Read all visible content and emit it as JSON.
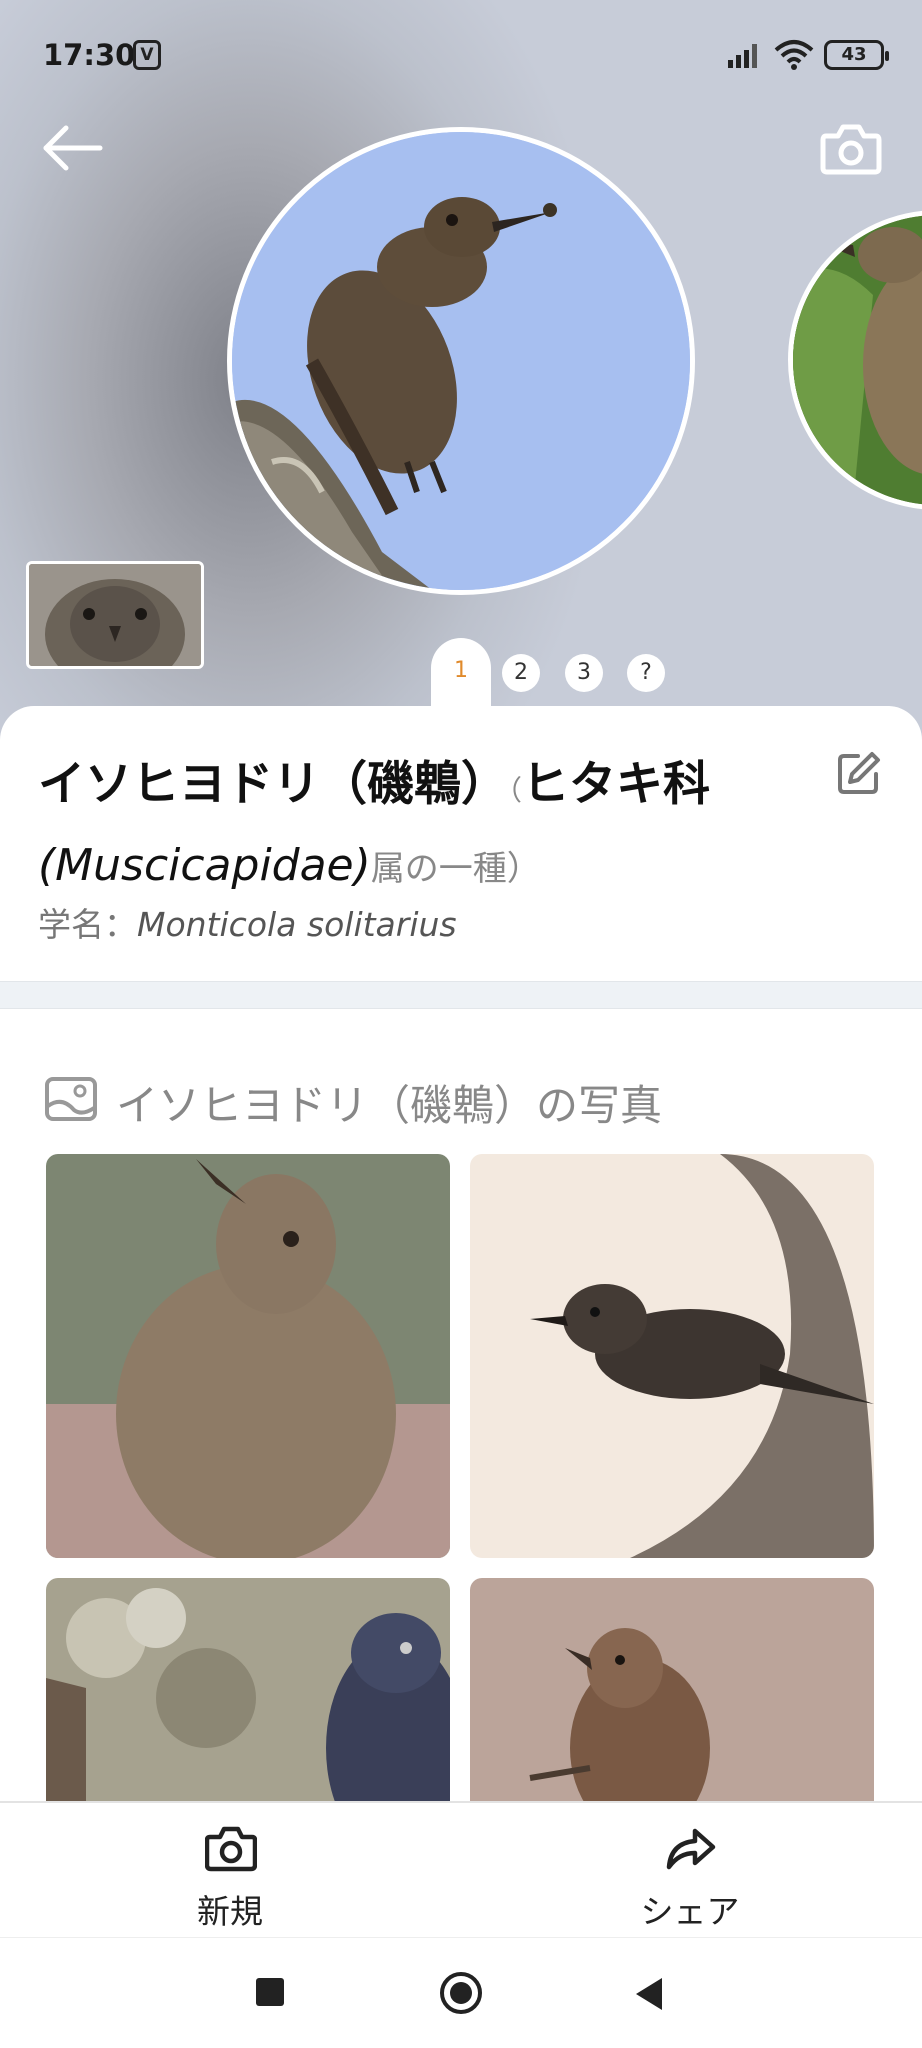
{
  "status_bar": {
    "time": "17:30",
    "app_badge": "V",
    "battery": "43"
  },
  "header": {
    "back_icon": "arrow-left-icon",
    "camera_icon": "camera-icon",
    "pager": [
      "1",
      "2",
      "3",
      "?"
    ],
    "active_page": "1",
    "accent_color": "#e08a2b"
  },
  "species": {
    "name": "イソヒヨドリ（磯鵯）",
    "family_open": "（",
    "family_name": "ヒタキ科",
    "family_latin": "(Muscicapidae)",
    "family_suffix": "属の一種）",
    "sci_label": "学名：",
    "sci_name": "Monticola solitarius"
  },
  "photos_section": {
    "heading": "イソヒヨドリ（磯鵯）の写真",
    "icon": "gallery-icon"
  },
  "bottom_nav": {
    "new_label": "新規",
    "share_label": "シェア"
  }
}
